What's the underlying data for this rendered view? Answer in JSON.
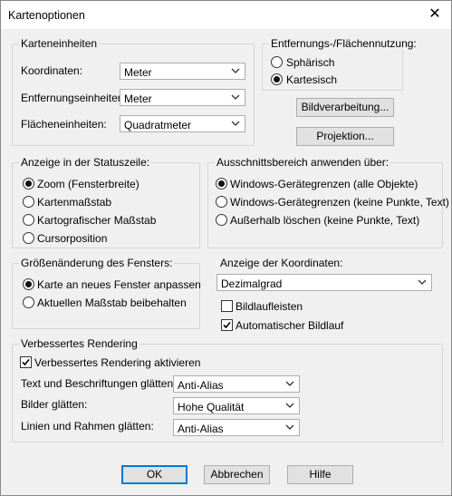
{
  "window": {
    "title": "Kartenoptionen",
    "close": "✕"
  },
  "karteneinheiten": {
    "legend": "Karteneinheiten",
    "rows": [
      {
        "label": "Koordinaten:",
        "value": "Meter"
      },
      {
        "label": "Entfernungseinheiten:",
        "value": "Meter"
      },
      {
        "label": "Flächeneinheiten:",
        "value": "Quadratmeter"
      }
    ]
  },
  "entfernung": {
    "legend": "Entfernungs-/Flächennutzung:",
    "options": [
      {
        "label": "Sphärisch",
        "selected": false
      },
      {
        "label": "Kartesisch",
        "selected": true
      }
    ]
  },
  "buttons": {
    "bildverarbeitung": "Bildverarbeitung...",
    "projektion": "Projektion...",
    "ok": "OK",
    "abbrechen": "Abbrechen",
    "hilfe": "Hilfe"
  },
  "statuszeile": {
    "legend": "Anzeige in der Statuszeile:",
    "options": [
      {
        "label": "Zoom (Fensterbreite)",
        "selected": true
      },
      {
        "label": "Kartenmaßstab",
        "selected": false
      },
      {
        "label": "Kartografischer Maßstab",
        "selected": false
      },
      {
        "label": "Cursorposition",
        "selected": false
      }
    ]
  },
  "ausschnitt": {
    "legend": "Ausschnittsbereich anwenden über:",
    "options": [
      {
        "label": "Windows-Gerätegrenzen (alle Objekte)",
        "selected": true
      },
      {
        "label": "Windows-Gerätegrenzen (keine Punkte, Text)",
        "selected": false
      },
      {
        "label": "Außerhalb löschen (keine Punkte, Text)",
        "selected": false
      }
    ]
  },
  "groessen": {
    "legend": "Größenänderung des Fensters:",
    "options": [
      {
        "label": "Karte an neues Fenster anpassen",
        "selected": true
      },
      {
        "label": "Aktuellen Maßstab beibehalten",
        "selected": false
      }
    ]
  },
  "koordinaten": {
    "label": "Anzeige der Koordinaten:",
    "value": "Dezimalgrad",
    "checks": [
      {
        "label": "Bildlaufleisten",
        "checked": false
      },
      {
        "label": "Automatischer Bildlauf",
        "checked": true
      }
    ]
  },
  "rendering": {
    "legend": "Verbessertes Rendering",
    "check": {
      "label": "Verbessertes Rendering aktivieren",
      "checked": true
    },
    "rows": [
      {
        "label": "Text und Beschriftungen glätten:",
        "value": "Anti-Alias"
      },
      {
        "label": "Bilder glätten:",
        "value": "Hohe Qualität"
      },
      {
        "label": "Linien und Rahmen glätten:",
        "value": "Anti-Alias"
      }
    ]
  }
}
